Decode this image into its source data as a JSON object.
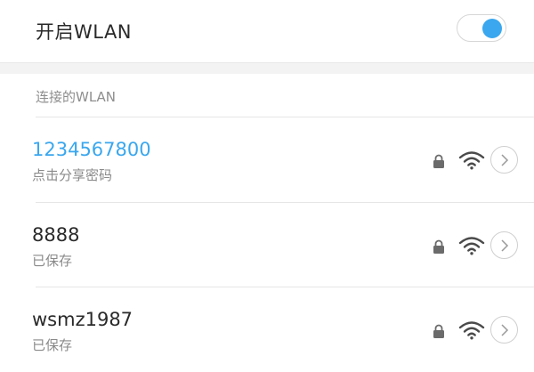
{
  "wlan_toggle": {
    "label": "开启WLAN",
    "state": "on",
    "accent_color": "#3aa7ee"
  },
  "connected_section": {
    "header": "连接的WLAN"
  },
  "networks": [
    {
      "name": "1234567800",
      "subtitle": "点击分享密码",
      "name_color": "#3aa7ee",
      "locked": true,
      "icon": "wifi-icon"
    },
    {
      "name": "8888",
      "subtitle": "已保存",
      "name_color": "#2a2a2a",
      "locked": true,
      "icon": "wifi-icon"
    },
    {
      "name": "wsmz1987",
      "subtitle": "已保存",
      "name_color": "#2a2a2a",
      "locked": true,
      "icon": "wifi-icon"
    }
  ]
}
